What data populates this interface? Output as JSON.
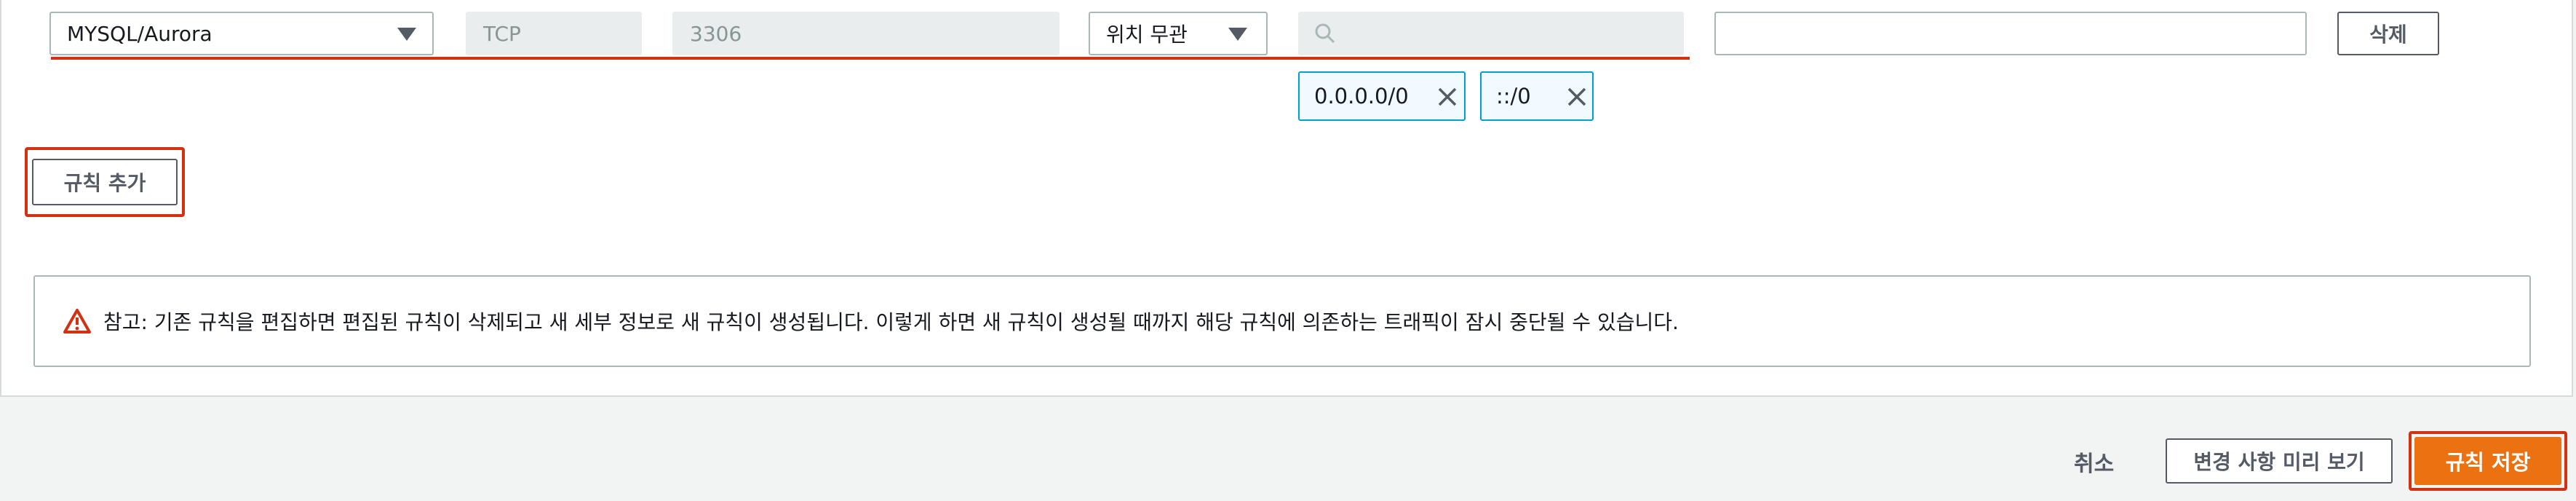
{
  "rule_row": {
    "type_value": "MYSQL/Aurora",
    "protocol_value": "TCP",
    "port_range_value": "3306",
    "source_value": "위치 무관",
    "source_search_placeholder": "",
    "description_value": "",
    "delete_label": "삭제",
    "cidr_chips": [
      "0.0.0.0/0",
      "::/0"
    ]
  },
  "add_rule_label": "규칙 추가",
  "note_text": "참고: 기존 규칙을 편집하면 편집된 규칙이 삭제되고 새 세부 정보로 새 규칙이 생성됩니다. 이렇게 하면 새 규칙이 생성될 때까지 해당 규칙에 의존하는 트래픽이 잠시 중단될 수 있습니다.",
  "footer": {
    "cancel_label": "취소",
    "preview_label": "변경 사항 미리 보기",
    "save_label": "규칙 저장"
  },
  "colors": {
    "accent": "#ec7211",
    "highlight_red": "#d13212",
    "chip_border": "#00a1c9"
  },
  "icons": [
    "chevron-down-icon",
    "search-icon",
    "close-icon",
    "warning-icon"
  ]
}
